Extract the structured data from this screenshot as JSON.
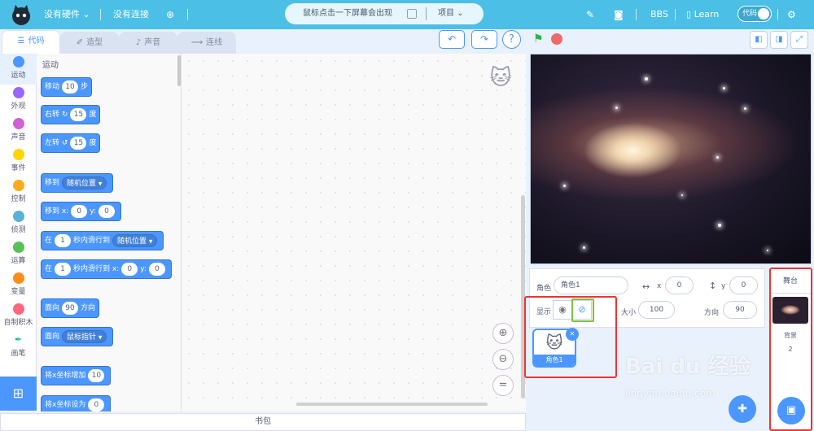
{
  "topbar": {
    "hardware": "没有硬件",
    "connection": "没有连接",
    "notice": "鼠标点击一下屏幕会出现",
    "project": "项目",
    "bbs": "BBS",
    "learn": "Learn",
    "toggle_label": "代码"
  },
  "tabs": [
    {
      "label": "代码",
      "icon": "code-icon"
    },
    {
      "label": "造型",
      "icon": "brush-icon"
    },
    {
      "label": "声音",
      "icon": "speaker-icon"
    },
    {
      "label": "连线",
      "icon": "wire-icon"
    }
  ],
  "categories": [
    {
      "label": "运动",
      "color": "#4c97ff"
    },
    {
      "label": "外观",
      "color": "#9966ff"
    },
    {
      "label": "声音",
      "color": "#cf63cf"
    },
    {
      "label": "事件",
      "color": "#ffd500"
    },
    {
      "label": "控制",
      "color": "#ffab19"
    },
    {
      "label": "侦测",
      "color": "#5cb1d6"
    },
    {
      "label": "运算",
      "color": "#59c059"
    },
    {
      "label": "变量",
      "color": "#ff8c1a"
    },
    {
      "label": "自制积木",
      "color": "#ff6680"
    },
    {
      "label": "画笔",
      "color": "#0fbd8c"
    }
  ],
  "palette": {
    "title": "运动",
    "blocks": {
      "move": {
        "a": "移动",
        "v": "10",
        "b": "步"
      },
      "turn_right": {
        "a": "右转",
        "v": "15",
        "b": "度"
      },
      "turn_left": {
        "a": "左转",
        "v": "15",
        "b": "度"
      },
      "goto": {
        "a": "移到",
        "dd": "随机位置"
      },
      "goto_xy": {
        "a": "移到 x:",
        "x": "0",
        "ylbl": "y:",
        "y": "0"
      },
      "glide": {
        "a": "在",
        "v": "1",
        "b": "秒内滑行到",
        "dd": "随机位置"
      },
      "glide_xy": {
        "a": "在",
        "v": "1",
        "b": "秒内滑行到 x:",
        "x": "0",
        "ylbl": "y:",
        "y": "0"
      },
      "point_dir": {
        "a": "面向",
        "v": "90",
        "b": "方向"
      },
      "point_towards": {
        "a": "面向",
        "dd": "鼠标指针"
      },
      "change_x": {
        "a": "将x坐标增加",
        "v": "10"
      },
      "set_x": {
        "a": "将x坐标设为",
        "v": "0"
      }
    }
  },
  "backpack": "书包",
  "sprite_panel": {
    "sprite_label": "角色",
    "sprite_name": "角色1",
    "x_label": "x",
    "x_value": "0",
    "y_label": "y",
    "y_value": "0",
    "show_label": "显示",
    "size_label": "大小",
    "size_value": "100",
    "direction_label": "方向",
    "direction_value": "90",
    "tile_name": "角色1"
  },
  "stage_panel": {
    "title": "舞台",
    "backdrop_label": "背景",
    "backdrop_count": "2"
  },
  "watermark": {
    "main": "Bai du 经验",
    "sub": "jingyan.baidu.com"
  },
  "colors": {
    "topbar": "#4cbfe6",
    "accent": "#4c97ff",
    "highlight_red": "#e33333",
    "highlight_green": "#7dc242"
  }
}
